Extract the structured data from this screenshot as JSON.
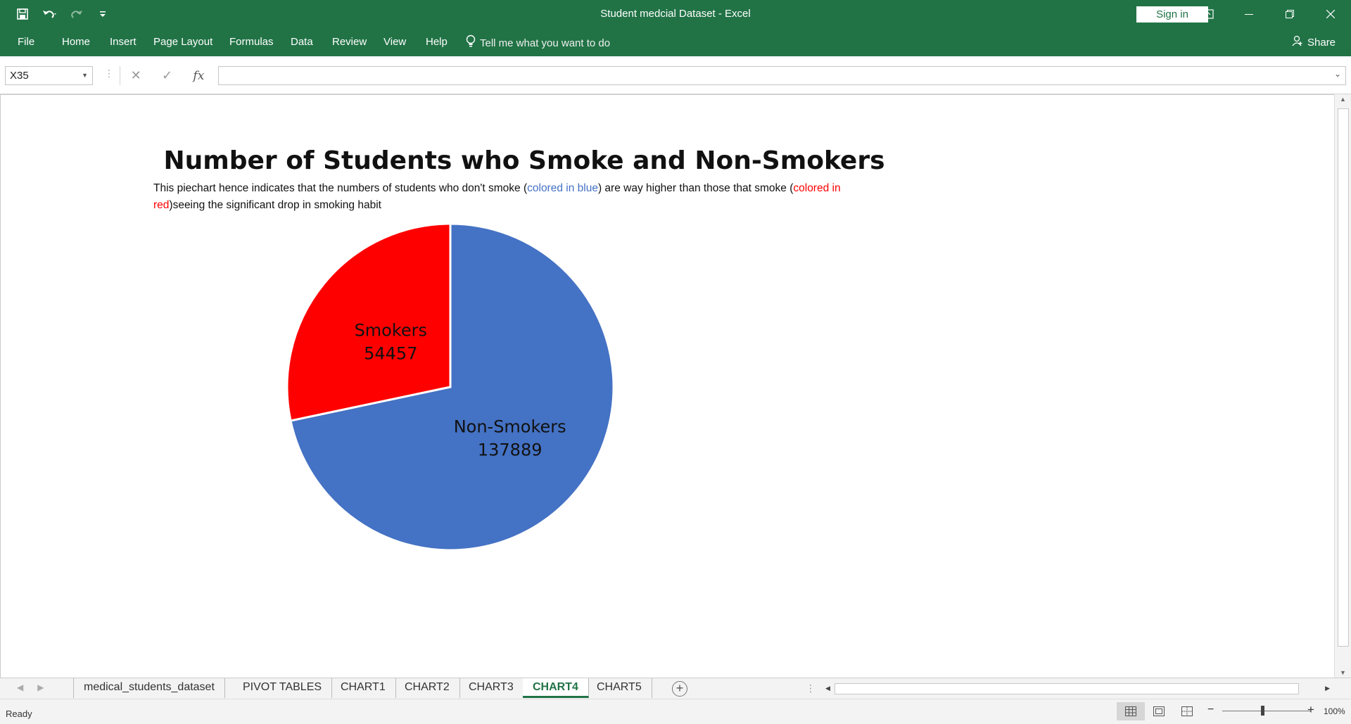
{
  "window": {
    "title": "Student medcial Dataset  -  Excel",
    "sign_in": "Sign in"
  },
  "ribbon": {
    "tabs": [
      "File",
      "Home",
      "Insert",
      "Page Layout",
      "Formulas",
      "Data",
      "Review",
      "View",
      "Help"
    ],
    "tell_me": "Tell me what you want to do",
    "share": "Share"
  },
  "formula_bar": {
    "name_box": "X35",
    "fx": "fx",
    "value": ""
  },
  "chart": {
    "title": "Number of Students who Smoke and Non-Smokers",
    "description": {
      "part1": "This piechart hence indicates that the numbers of students who don't smoke (",
      "blue_text": "colored in blue",
      "part2": ") are way higher than those that smoke (",
      "red_text": "colored in red",
      "part3": ")seeing the significant drop in smoking habit"
    },
    "colors": {
      "non_smokers": "#4472c4",
      "smokers": "#ff0000"
    }
  },
  "chart_data": {
    "type": "pie",
    "title": "Number of Students who Smoke and Non-Smokers",
    "categories": [
      "Non-Smokers",
      "Smokers"
    ],
    "values": [
      137889,
      54457
    ],
    "colors": [
      "#4472c4",
      "#ff0000"
    ]
  },
  "sheet_tabs": {
    "tabs": [
      "medical_students_dataset",
      "PIVOT TABLES",
      "CHART1",
      "CHART2",
      "CHART3",
      "CHART4",
      "CHART5"
    ],
    "active": "CHART4"
  },
  "status": {
    "text": "Ready",
    "zoom": "100%"
  }
}
